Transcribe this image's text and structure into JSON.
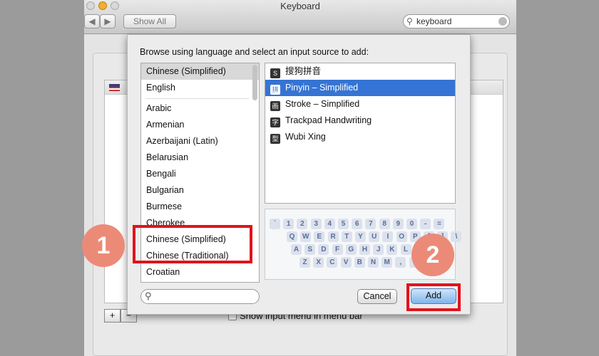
{
  "window": {
    "title": "Keyboard",
    "show_all": "Show All",
    "back": "◀",
    "forward": "▶",
    "search_value": "keyboard"
  },
  "background": {
    "checkbox_label": "Show input menu in menu bar",
    "add": "+",
    "remove": "−"
  },
  "dialog": {
    "prompt": "Browse using language and select an input source to add:",
    "languages": [
      "Chinese (Simplified)",
      "English",
      "Arabic",
      "Armenian",
      "Azerbaijani (Latin)",
      "Belarusian",
      "Bengali",
      "Bulgarian",
      "Burmese",
      "Cherokee",
      "Chinese (Simplified)",
      "Chinese (Traditional)",
      "Croatian"
    ],
    "selected_language": "Chinese (Simplified)",
    "sources": [
      {
        "icon": "S",
        "label": "搜狗拼音"
      },
      {
        "icon": "拼",
        "label": "Pinyin – Simplified"
      },
      {
        "icon": "画",
        "label": "Stroke – Simplified"
      },
      {
        "icon": "字",
        "label": "Trackpad Handwriting"
      },
      {
        "icon": "型",
        "label": "Wubi Xing"
      }
    ],
    "selected_source": "Pinyin – Simplified",
    "keyboard_rows": [
      [
        "`",
        "1",
        "2",
        "3",
        "4",
        "5",
        "6",
        "7",
        "8",
        "9",
        "0",
        "-",
        "="
      ],
      [
        "Q",
        "W",
        "E",
        "R",
        "T",
        "Y",
        "U",
        "I",
        "O",
        "P",
        "[",
        "]",
        "\\"
      ],
      [
        "A",
        "S",
        "D",
        "F",
        "G",
        "H",
        "J",
        "K",
        "L",
        ";",
        "'"
      ],
      [
        "Z",
        "X",
        "C",
        "V",
        "B",
        "N",
        "M",
        ",",
        ".",
        "/"
      ]
    ],
    "search_placeholder": "",
    "cancel": "Cancel",
    "add": "Add"
  },
  "annotations": {
    "step1": "1",
    "step2": "2",
    "highlight_color": "#e0141b",
    "circle_color": "#ec8a78"
  },
  "colors": {
    "selection_blue": "#3574d4"
  }
}
